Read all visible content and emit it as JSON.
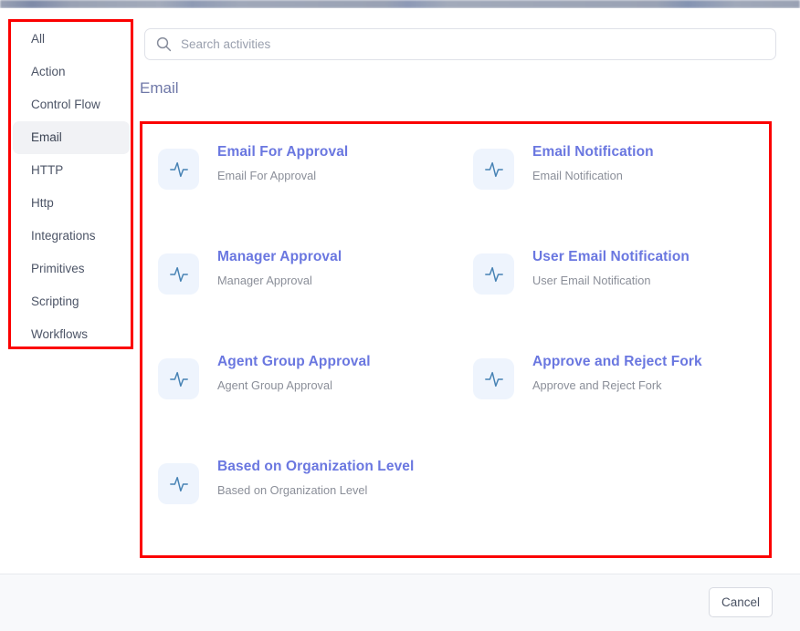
{
  "sidebar": {
    "items": [
      {
        "label": "All",
        "selected": false
      },
      {
        "label": "Action",
        "selected": false
      },
      {
        "label": "Control Flow",
        "selected": false
      },
      {
        "label": "Email",
        "selected": true
      },
      {
        "label": "HTTP",
        "selected": false
      },
      {
        "label": "Http",
        "selected": false
      },
      {
        "label": "Integrations",
        "selected": false
      },
      {
        "label": "Primitives",
        "selected": false
      },
      {
        "label": "Scripting",
        "selected": false
      },
      {
        "label": "Workflows",
        "selected": false
      }
    ]
  },
  "search": {
    "placeholder": "Search activities",
    "value": "",
    "icon": "search-icon"
  },
  "main": {
    "section_title": "Email",
    "cards": [
      {
        "title": "Email For Approval",
        "subtitle": "Email For Approval",
        "icon": "activity-pulse-icon"
      },
      {
        "title": "Email Notification",
        "subtitle": "Email Notification",
        "icon": "activity-pulse-icon"
      },
      {
        "title": "Manager Approval",
        "subtitle": "Manager Approval",
        "icon": "activity-pulse-icon"
      },
      {
        "title": "User Email Notification",
        "subtitle": "User Email Notification",
        "icon": "activity-pulse-icon"
      },
      {
        "title": "Agent Group Approval",
        "subtitle": "Agent Group Approval",
        "icon": "activity-pulse-icon"
      },
      {
        "title": "Approve and Reject Fork",
        "subtitle": "Approve and Reject Fork",
        "icon": "activity-pulse-icon"
      },
      {
        "title": "Based on Organization Level",
        "subtitle": "Based on Organization Level",
        "icon": "activity-pulse-icon"
      }
    ]
  },
  "footer": {
    "cancel_label": "Cancel"
  },
  "colors": {
    "card_title": "#6a77e0",
    "section_title": "#6f78a8",
    "icon_tile_bg": "#eef4fd",
    "icon_stroke": "#4682b4",
    "selected_item_bg": "#f1f2f5",
    "annotation": "#fb0000",
    "footer_bg": "#f8f9fb"
  }
}
